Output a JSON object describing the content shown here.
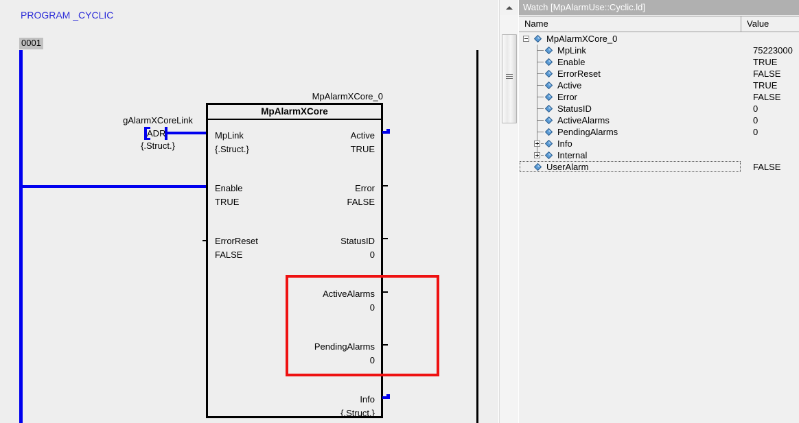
{
  "editor": {
    "program_title": "PROGRAM _CYCLIC",
    "network_number": "0001",
    "input_variable": {
      "name": "gAlarmXCoreLink",
      "connector_label": "ADR",
      "type": "{.Struct.}"
    },
    "function_block": {
      "instance_name": "MpAlarmXCore_0",
      "type_name": "MpAlarmXCore",
      "inputs": [
        {
          "label": "MpLink",
          "value": "{.Struct.}"
        },
        {
          "label": "Enable",
          "value": "TRUE"
        },
        {
          "label": "ErrorReset",
          "value": "FALSE"
        }
      ],
      "outputs": [
        {
          "label": "Active",
          "value": "TRUE"
        },
        {
          "label": "Error",
          "value": "FALSE"
        },
        {
          "label": "StatusID",
          "value": "0"
        },
        {
          "label": "ActiveAlarms",
          "value": "0"
        },
        {
          "label": "PendingAlarms",
          "value": "0"
        },
        {
          "label": "Info",
          "value": "{.Struct.}"
        }
      ]
    },
    "annotation": {
      "color": "#ee1111",
      "shape": "rectangle"
    }
  },
  "watch": {
    "title": "Watch [MpAlarmUse::Cyclic.ld]",
    "columns": {
      "name": "Name",
      "value": "Value"
    },
    "rows": [
      {
        "label": "MpAlarmXCore_0",
        "value": "",
        "depth": 0,
        "expander": "minus",
        "focused": false
      },
      {
        "label": "MpLink",
        "value": "75223000",
        "depth": 1,
        "expander": "none",
        "focused": false
      },
      {
        "label": "Enable",
        "value": "TRUE",
        "depth": 1,
        "expander": "none",
        "focused": false
      },
      {
        "label": "ErrorReset",
        "value": "FALSE",
        "depth": 1,
        "expander": "none",
        "focused": false
      },
      {
        "label": "Active",
        "value": "TRUE",
        "depth": 1,
        "expander": "none",
        "focused": false
      },
      {
        "label": "Error",
        "value": "FALSE",
        "depth": 1,
        "expander": "none",
        "focused": false
      },
      {
        "label": "StatusID",
        "value": "0",
        "depth": 1,
        "expander": "none",
        "focused": false
      },
      {
        "label": "ActiveAlarms",
        "value": "0",
        "depth": 1,
        "expander": "none",
        "focused": false
      },
      {
        "label": "PendingAlarms",
        "value": "0",
        "depth": 1,
        "expander": "none",
        "focused": false
      },
      {
        "label": "Info",
        "value": "",
        "depth": 1,
        "expander": "plus",
        "focused": false
      },
      {
        "label": "Internal",
        "value": "",
        "depth": 1,
        "expander": "plus",
        "focused": false
      },
      {
        "label": "UserAlarm",
        "value": "FALSE",
        "depth": 0,
        "expander": "none",
        "focused": true
      }
    ]
  },
  "scrollbar": {
    "up_arrow": "scroll-up-arrow",
    "thumb": "scroll-thumb"
  }
}
